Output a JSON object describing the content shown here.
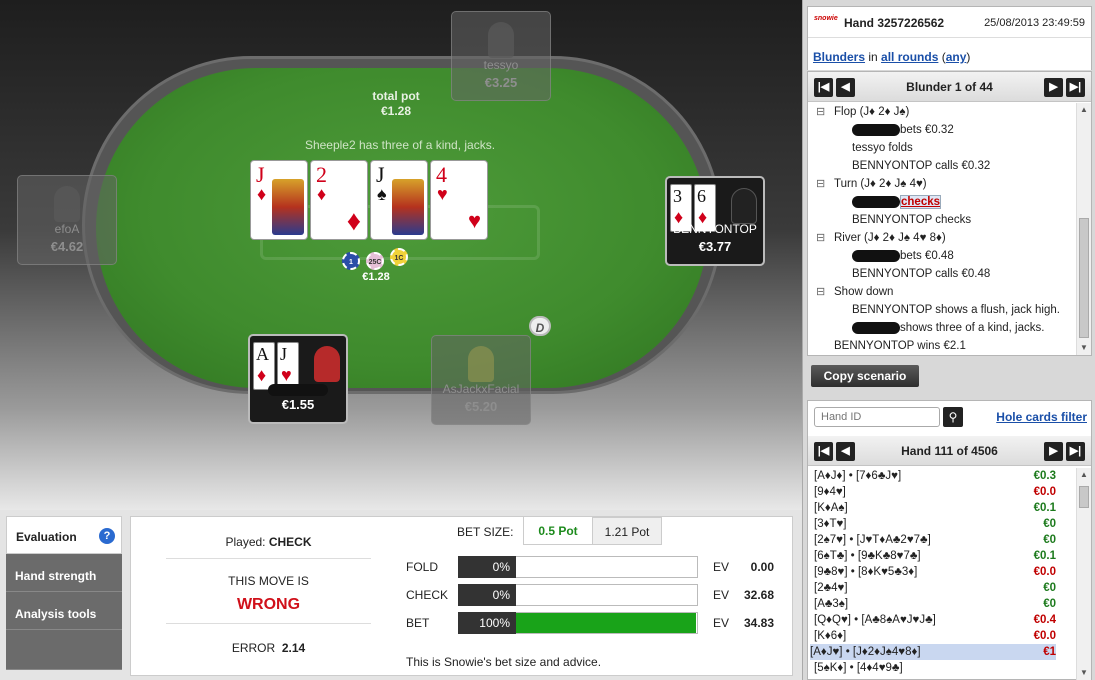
{
  "table": {
    "total_pot_label": "total pot",
    "total_pot_value": "€1.28",
    "hand_message": "Sheeple2 has three of a kind, jacks.",
    "pot_chips_value": "€1.28",
    "dealer_button": "D",
    "chips": [
      "1",
      "25C",
      "1C"
    ],
    "board": [
      {
        "rank": "J",
        "suit": "♦",
        "color": "red"
      },
      {
        "rank": "2",
        "suit": "♦",
        "color": "red"
      },
      {
        "rank": "J",
        "suit": "♠",
        "color": "black"
      },
      {
        "rank": "4",
        "suit": "♥",
        "color": "red"
      }
    ],
    "seats": [
      {
        "name": "tessyo",
        "stack": "€3.25"
      },
      {
        "name": "efoA",
        "stack": "€4.62"
      },
      {
        "name": "BENNYONTOP",
        "stack": "€3.77",
        "cards": [
          {
            "rank": "3",
            "suit": "♦"
          },
          {
            "rank": "6",
            "suit": "♦"
          }
        ]
      },
      {
        "name": "",
        "stack": "€1.55",
        "cards": [
          {
            "rank": "A",
            "suit": "♦"
          },
          {
            "rank": "J",
            "suit": "♥"
          }
        ]
      },
      {
        "name": "AsJackxFacial",
        "stack": "€5.20"
      }
    ]
  },
  "header": {
    "logo": "snowie",
    "hand_title": "Hand 3257226562",
    "datetime": "25/08/2013 23:49:59"
  },
  "filter": {
    "blunders": "Blunders",
    "in": "in",
    "all_rounds": "all rounds",
    "any": "any"
  },
  "blunder_nav": {
    "title": "Blunder 1 of 44"
  },
  "history": [
    {
      "text": "Flop (J♦ 2♦ J♠)",
      "indent": 1,
      "toggle": true
    },
    {
      "text": "bets €0.32",
      "indent": 2,
      "redacted": true
    },
    {
      "text": "tessyo folds",
      "indent": 2
    },
    {
      "text": "BENNYONTOP calls €0.32",
      "indent": 2
    },
    {
      "text": "Turn (J♦ 2♦ J♠ 4♥)",
      "indent": 1,
      "toggle": true
    },
    {
      "text": "checks",
      "indent": 2,
      "redacted": true,
      "highlight": true
    },
    {
      "text": "BENNYONTOP checks",
      "indent": 2
    },
    {
      "text": "River (J♦ 2♦ J♠ 4♥ 8♦)",
      "indent": 1,
      "toggle": true
    },
    {
      "text": "bets €0.48",
      "indent": 2,
      "redacted": true
    },
    {
      "text": "BENNYONTOP calls €0.48",
      "indent": 2
    },
    {
      "text": "Show down",
      "indent": 1,
      "toggle": true
    },
    {
      "text": "BENNYONTOP shows a flush, jack high.",
      "indent": 2
    },
    {
      "text": "shows three of a kind, jacks.",
      "indent": 2,
      "redacted": true
    },
    {
      "text": "BENNYONTOP wins €2.1",
      "indent": 1
    }
  ],
  "copy_scenario": "Copy scenario",
  "hand_search": {
    "placeholder": "Hand ID",
    "filter_link": "Hole cards filter"
  },
  "hand_nav": {
    "title": "Hand 111 of 4506"
  },
  "hand_list": [
    {
      "text": "[A♦J♦] • [7♦6♣J♥]",
      "value": "€0.3",
      "sign": "pos"
    },
    {
      "text": "[9♦4♥]",
      "value": "€0.0",
      "sign": "neg"
    },
    {
      "text": "[K♦A♠]",
      "value": "€0.1",
      "sign": "pos"
    },
    {
      "text": "[3♦T♥]",
      "value": "€0",
      "sign": "pos"
    },
    {
      "text": "[2♠7♥] • [J♥T♦A♣2♥7♣]",
      "value": "€0",
      "sign": "pos"
    },
    {
      "text": "[6♠T♣] • [9♣K♣8♥7♣]",
      "value": "€0.1",
      "sign": "pos"
    },
    {
      "text": "[9♣8♥] • [8♦K♥5♣3♦]",
      "value": "€0.0",
      "sign": "neg"
    },
    {
      "text": "[2♣4♥]",
      "value": "€0",
      "sign": "pos"
    },
    {
      "text": "[A♣3♠]",
      "value": "€0",
      "sign": "pos"
    },
    {
      "text": "[Q♦Q♥] • [A♣8♠A♥J♥J♣]",
      "value": "€0.4",
      "sign": "neg"
    },
    {
      "text": "[K♦6♦]",
      "value": "€0.0",
      "sign": "neg"
    },
    {
      "text": "[A♦J♥] • [J♦2♦J♠4♥8♦]",
      "value": "€1",
      "sign": "neg",
      "selected": true
    },
    {
      "text": "[5♠K♦] • [4♦4♥9♣]",
      "value": "",
      "sign": "pos"
    }
  ],
  "tabs": [
    "Evaluation",
    "Hand strength",
    "Analysis tools"
  ],
  "evaluation": {
    "played_label": "Played:",
    "played_value": "CHECK",
    "move_is_label": "THIS MOVE IS",
    "verdict": "WRONG",
    "error_label": "ERROR",
    "error_value": "2.14",
    "bet_size_label": "BET SIZE:",
    "bet_size_options": [
      "0.5 Pot",
      "1.21 Pot"
    ],
    "actions": [
      {
        "label": "FOLD",
        "pct_text": "0%",
        "pct": 0,
        "ev_label": "EV",
        "ev": "0.00"
      },
      {
        "label": "CHECK",
        "pct_text": "0%",
        "pct": 0,
        "ev_label": "EV",
        "ev": "32.68"
      },
      {
        "label": "BET",
        "pct_text": "100%",
        "pct": 100,
        "ev_label": "EV",
        "ev": "34.83"
      }
    ],
    "advice": "This is Snowie's bet size and advice.",
    "colors": {
      "wrong": "#d0101a",
      "bar": "#19a319",
      "selected_option": "#1c8a1c"
    }
  }
}
